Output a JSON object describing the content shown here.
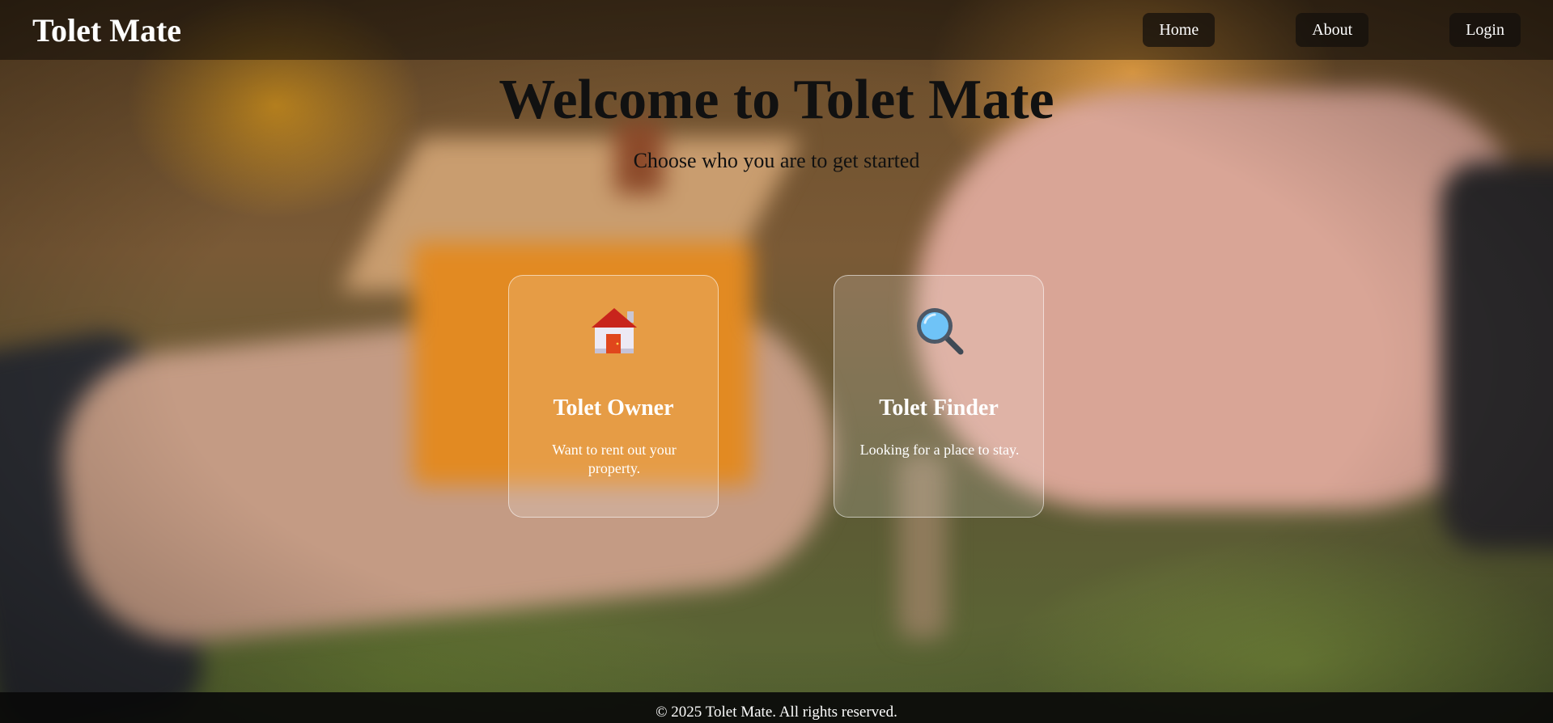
{
  "header": {
    "brand": "Tolet Mate",
    "nav": {
      "home": "Home",
      "about": "About",
      "login": "Login"
    }
  },
  "hero": {
    "title": "Welcome to Tolet Mate",
    "subtitle": "Choose who you are to get started"
  },
  "cards": {
    "owner": {
      "icon": "house-icon",
      "title": "Tolet Owner",
      "text": "Want to rent out your property."
    },
    "finder": {
      "icon": "magnifier-icon",
      "title": "Tolet Finder",
      "text": "Looking for a place to stay."
    }
  },
  "footer": {
    "text": "© 2025 Tolet Mate. All rights reserved."
  },
  "colors": {
    "nav_bg": "#1a1410",
    "title": "#111111",
    "footer_bg": "#0a0a0a"
  }
}
